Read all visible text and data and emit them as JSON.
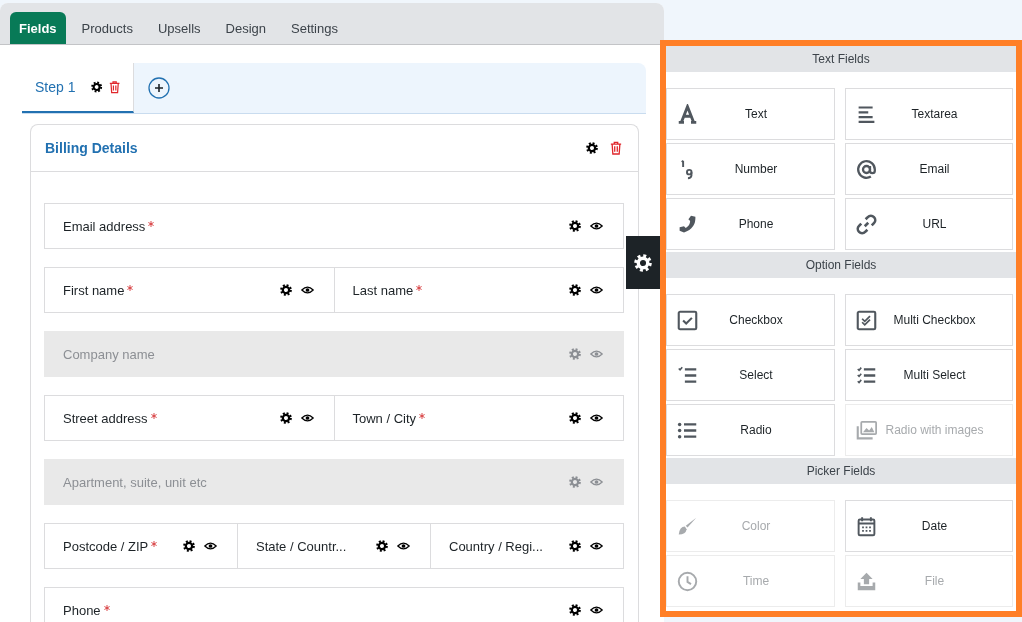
{
  "tabs": [
    {
      "label": "Fields",
      "selected": true
    },
    {
      "label": "Products",
      "selected": false
    },
    {
      "label": "Upsells",
      "selected": false
    },
    {
      "label": "Design",
      "selected": false
    },
    {
      "label": "Settings",
      "selected": false
    }
  ],
  "steps": [
    {
      "label": "Step 1",
      "selected": true
    }
  ],
  "section": {
    "title": "Billing Details"
  },
  "rows": [
    {
      "fields": [
        {
          "label": "Email address",
          "required": true,
          "disabled": false
        }
      ]
    },
    {
      "fields": [
        {
          "label": "First name",
          "required": true,
          "disabled": false
        },
        {
          "label": "Last name",
          "required": true,
          "disabled": false
        }
      ]
    },
    {
      "fields": [
        {
          "label": "Company name",
          "required": false,
          "disabled": true
        }
      ]
    },
    {
      "fields": [
        {
          "label": "Street address",
          "required": true,
          "disabled": false
        },
        {
          "label": "Town / City",
          "required": true,
          "disabled": false
        }
      ]
    },
    {
      "fields": [
        {
          "label": "Apartment, suite, unit etc",
          "required": false,
          "disabled": true
        }
      ]
    },
    {
      "fields": [
        {
          "label": "Postcode / ZIP",
          "required": true,
          "disabled": false
        },
        {
          "label": "State / Countr...",
          "required": false,
          "disabled": false
        },
        {
          "label": "Country / Regi...",
          "required": false,
          "disabled": false
        }
      ]
    },
    {
      "fields": [
        {
          "label": "Phone",
          "required": true,
          "disabled": false
        }
      ]
    }
  ],
  "palette": [
    {
      "title": "Text Fields",
      "items": [
        {
          "label": "Text",
          "disabled": false
        },
        {
          "label": "Textarea",
          "disabled": false
        },
        {
          "label": "Number",
          "disabled": false
        },
        {
          "label": "Email",
          "disabled": false
        },
        {
          "label": "Phone",
          "disabled": false
        },
        {
          "label": "URL",
          "disabled": false
        }
      ]
    },
    {
      "title": "Option Fields",
      "items": [
        {
          "label": "Checkbox",
          "disabled": false
        },
        {
          "label": "Multi Checkbox",
          "disabled": false
        },
        {
          "label": "Select",
          "disabled": false
        },
        {
          "label": "Multi Select",
          "disabled": false
        },
        {
          "label": "Radio",
          "disabled": false
        },
        {
          "label": "Radio with images",
          "disabled": true
        }
      ]
    },
    {
      "title": "Picker Fields",
      "items": [
        {
          "label": "Color",
          "disabled": true
        },
        {
          "label": "Date",
          "disabled": false
        },
        {
          "label": "Time",
          "disabled": true
        },
        {
          "label": "File",
          "disabled": true
        }
      ]
    }
  ]
}
